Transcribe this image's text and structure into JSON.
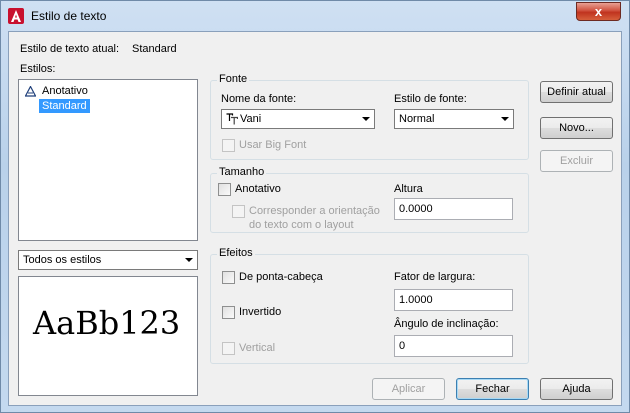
{
  "window": {
    "title": "Estilo de texto",
    "close_glyph": "x"
  },
  "current_style": {
    "label": "Estilo de texto atual:",
    "value": "Standard"
  },
  "styles": {
    "label": "Estilos:",
    "tree": [
      {
        "label": "Anotativo",
        "icon": "annotative-icon"
      },
      {
        "label": "Standard",
        "selected": true
      }
    ],
    "filter": "Todos os estilos"
  },
  "preview": {
    "text": "AaBb123"
  },
  "font": {
    "group": "Fonte",
    "name_label": "Nome da fonte:",
    "name_value": "Vani",
    "style_label": "Estilo de fonte:",
    "style_value": "Normal",
    "big_font_label": "Usar Big Font"
  },
  "size": {
    "group": "Tamanho",
    "annotative_label": "Anotativo",
    "match_orientation_label_1": "Corresponder a orientação",
    "match_orientation_label_2": "do texto com o layout",
    "height_label": "Altura",
    "height_value": "0.0000"
  },
  "effects": {
    "group": "Efeitos",
    "upside_down_label": "De ponta-cabeça",
    "backwards_label": "Invertido",
    "vertical_label": "Vertical",
    "width_factor_label": "Fator de largura:",
    "width_factor_value": "1.0000",
    "oblique_label": "Ângulo de inclinação:",
    "oblique_value": "0"
  },
  "side_buttons": {
    "set_current": "Definir atual",
    "new": "Novo...",
    "delete": "Excluir"
  },
  "bottom_buttons": {
    "apply": "Aplicar",
    "close": "Fechar",
    "help": "Ajuda"
  },
  "colors": {
    "selection": "#3399ff",
    "accent": "#c0331f"
  }
}
